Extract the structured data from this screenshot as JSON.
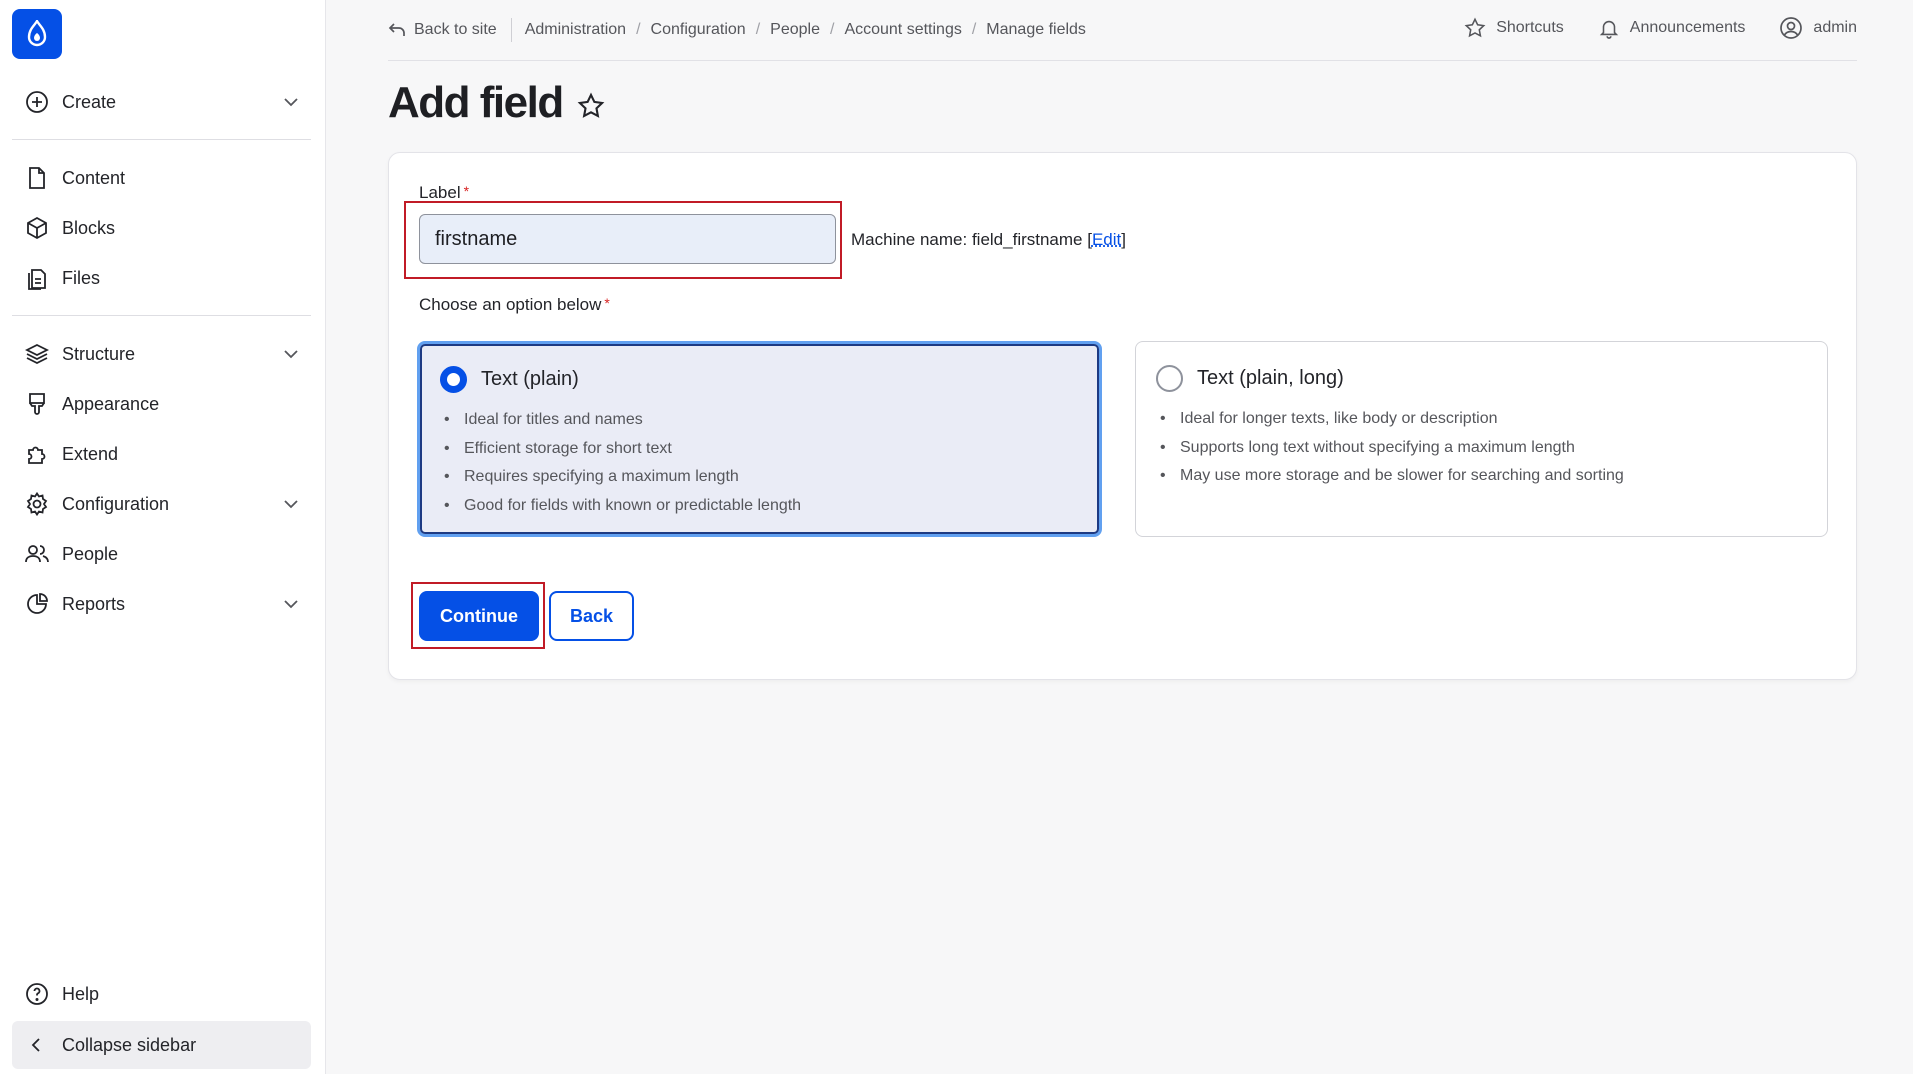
{
  "colors": {
    "accent": "#0550e6",
    "highlight": "#c11b26",
    "required": "#d72222"
  },
  "sidebar": {
    "logo_icon": "drupal-drop-icon",
    "create": {
      "label": "Create",
      "icon": "plus-circle-icon"
    },
    "items_top": [
      {
        "label": "Content",
        "icon": "document-icon"
      },
      {
        "label": "Blocks",
        "icon": "cube-icon"
      },
      {
        "label": "Files",
        "icon": "files-icon"
      }
    ],
    "items_main": [
      {
        "label": "Structure",
        "icon": "layers-icon",
        "expandable": true
      },
      {
        "label": "Appearance",
        "icon": "brush-icon",
        "expandable": false
      },
      {
        "label": "Extend",
        "icon": "puzzle-icon",
        "expandable": false
      },
      {
        "label": "Configuration",
        "icon": "gear-icon",
        "expandable": true
      },
      {
        "label": "People",
        "icon": "people-icon",
        "expandable": false
      },
      {
        "label": "Reports",
        "icon": "pie-chart-icon",
        "expandable": true
      }
    ],
    "help": {
      "label": "Help",
      "icon": "help-icon"
    },
    "collapse": {
      "label": "Collapse sidebar",
      "icon": "chevron-left-icon"
    }
  },
  "topbar": {
    "back_to_site": "Back to site",
    "breadcrumbs": [
      "Administration",
      "Configuration",
      "People",
      "Account settings",
      "Manage fields"
    ],
    "shortcuts": "Shortcuts",
    "announcements": "Announcements",
    "user": "admin"
  },
  "page": {
    "title": "Add field"
  },
  "form": {
    "label_text": "Label",
    "label_value": "firstname",
    "machine_prefix": "Machine name: field_firstname [",
    "machine_edit": "Edit",
    "machine_suffix": "]",
    "choose_text": "Choose an option below",
    "required_mark": "*",
    "options": [
      {
        "title": "Text (plain)",
        "selected": true,
        "bullets": [
          "Ideal for titles and names",
          "Efficient storage for short text",
          "Requires specifying a maximum length",
          "Good for fields with known or predictable length"
        ]
      },
      {
        "title": "Text (plain, long)",
        "selected": false,
        "bullets": [
          "Ideal for longer texts, like body or description",
          "Supports long text without specifying a maximum length",
          "May use more storage and be slower for searching and sorting"
        ]
      }
    ],
    "continue_label": "Continue",
    "back_label": "Back"
  }
}
